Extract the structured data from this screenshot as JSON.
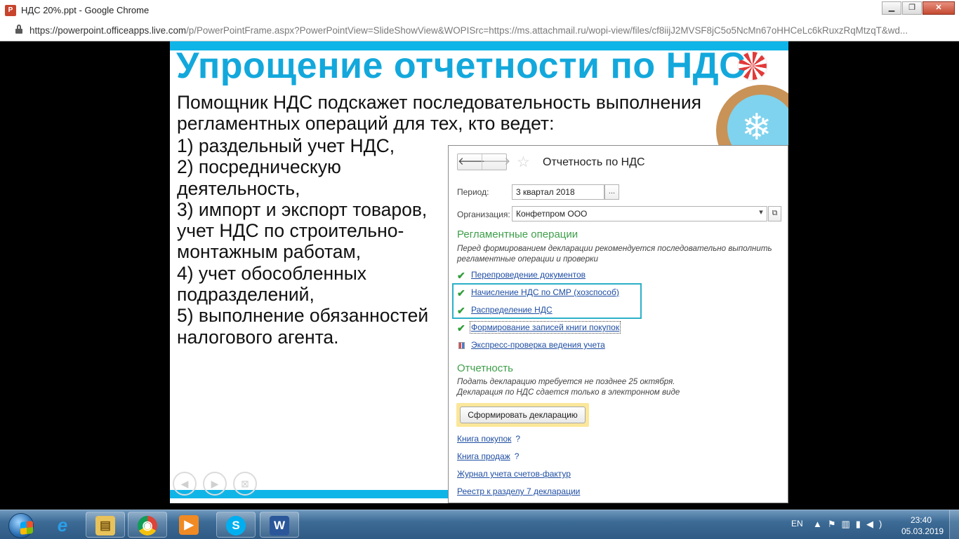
{
  "window": {
    "title": "НДС 20%.ppt - Google Chrome",
    "app_icon_letter": "P",
    "url_host": "https://powerpoint.officeapps.live.com",
    "url_rest": "/p/PowerPointFrame.aspx?PowerPointView=SlideShowView&WOPISrc=https://ms.attachmail.ru/wopi-view/files/cf8iijJ2MVSF8jC5o5NcMn67oHHCeLc6kRuxzRqMtzqT&wd..."
  },
  "slide": {
    "title": "Упрощение отчетности по НДС",
    "intro": "Помощник НДС подскажет последовательность выполнения регламентных операций для тех, кто ведет:",
    "items": [
      "1) раздельный учет НДС,",
      "2) посредническую деятельность,",
      "3) импорт и экспорт товаров, учет НДС по строительно-монтажным работам,",
      "4) учет обособленных подразделений,",
      "5) выполнение обязанностей налогового агента."
    ],
    "nav_prev": "◀",
    "nav_next": "▶",
    "nav_screen": "⊠"
  },
  "panel": {
    "nav_back": "🡐",
    "nav_forward": "🡒",
    "star": "☆",
    "title": "Отчетность по НДС",
    "period_label": "Период:",
    "period_value": "3 квартал 2018",
    "period_btn": "...",
    "org_label": "Организация:",
    "org_value": "Конфетпром ООО",
    "org_dropdown": "▾",
    "org_open": "⧉",
    "section_ops": "Регламентные операции",
    "ops_hint": "Перед формированием декларации рекомендуется последовательно выполнить регламентные  операции и проверки",
    "operations": [
      {
        "label": "Перепроведение документов",
        "icon": "check"
      },
      {
        "label": "Начисление НДС по СМР (хозспособ)",
        "icon": "check"
      },
      {
        "label": "Распределение НДС",
        "icon": "check"
      },
      {
        "label": "Формирование записей книги покупок",
        "icon": "check"
      },
      {
        "label": "Экспресс-проверка ведения учета",
        "icon": "report"
      }
    ],
    "check_glyph": "✔",
    "section_report": "Отчетность",
    "report_hint": "Подать декларацию требуется не позднее 25 октября. Декларация по НДС сдается только в электронном виде",
    "generate_btn": "Сформировать декларацию",
    "links": [
      {
        "label": "Книга покупок",
        "help": "?"
      },
      {
        "label": "Книга продаж",
        "help": "?"
      },
      {
        "label": "Журнал учета счетов-фактур",
        "help": ""
      },
      {
        "label": "Реестр к разделу 7 декларации",
        "help": ""
      }
    ]
  },
  "taskbar": {
    "apps": [
      "file-explorer",
      "chrome",
      "media-player",
      "skype",
      "word"
    ],
    "app_glyphs": [
      "e",
      "▤",
      "◉",
      "▶",
      "S",
      "W"
    ],
    "lang": "EN",
    "tray_glyphs": "▲⚑▥▮◀)",
    "time": "23:40",
    "date": "05.03.2019"
  },
  "colors": {
    "slide_accent": "#13a8dc",
    "section_green": "#3e9f4a",
    "link_blue": "#1f4ea3",
    "highlight_cyan": "#2bb0c8",
    "button_yellow": "#fbe79a"
  }
}
